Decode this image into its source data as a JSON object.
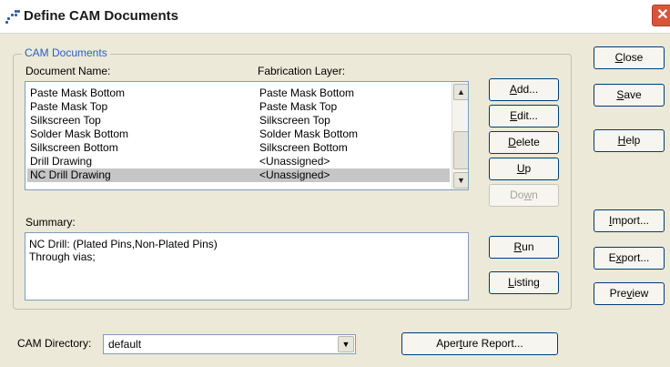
{
  "window": {
    "title": "Define CAM Documents",
    "close_glyph": "✕",
    "icon": "app-dots-icon"
  },
  "group": {
    "legend": "CAM Documents"
  },
  "list": {
    "col_document": "Document Name:",
    "col_layer": "Fabrication Layer:",
    "rows": [
      {
        "doc": "Paste Mask Bottom",
        "layer": "Paste Mask Bottom"
      },
      {
        "doc": "Paste Mask Top",
        "layer": "Paste Mask Top"
      },
      {
        "doc": "Silkscreen Top",
        "layer": "Silkscreen Top"
      },
      {
        "doc": "Solder Mask Bottom",
        "layer": "Solder Mask Bottom"
      },
      {
        "doc": "Silkscreen Bottom",
        "layer": "Silkscreen Bottom"
      },
      {
        "doc": "Drill Drawing",
        "layer": "<Unassigned>"
      },
      {
        "doc": "NC Drill Drawing",
        "layer": "<Unassigned>"
      }
    ],
    "selected_index": 6
  },
  "list_buttons": {
    "add": "Add...",
    "edit": "Edit...",
    "delete": "Delete",
    "up": "Up",
    "down": "Down"
  },
  "summary": {
    "label": "Summary:",
    "lines": [
      "NC Drill: (Plated Pins,Non-Plated Pins)",
      "Through vias;"
    ]
  },
  "action_buttons": {
    "run": "Run",
    "listing": "Listing"
  },
  "side_buttons": {
    "close": "Close",
    "save": "Save",
    "help": "Help",
    "import": "Import...",
    "export": "Export...",
    "preview": "Preview"
  },
  "cam_directory": {
    "label": "CAM Directory:",
    "value": "default"
  },
  "aperture_report": "Aperture Report...",
  "glyphs": {
    "up": "▲",
    "down": "▼"
  }
}
